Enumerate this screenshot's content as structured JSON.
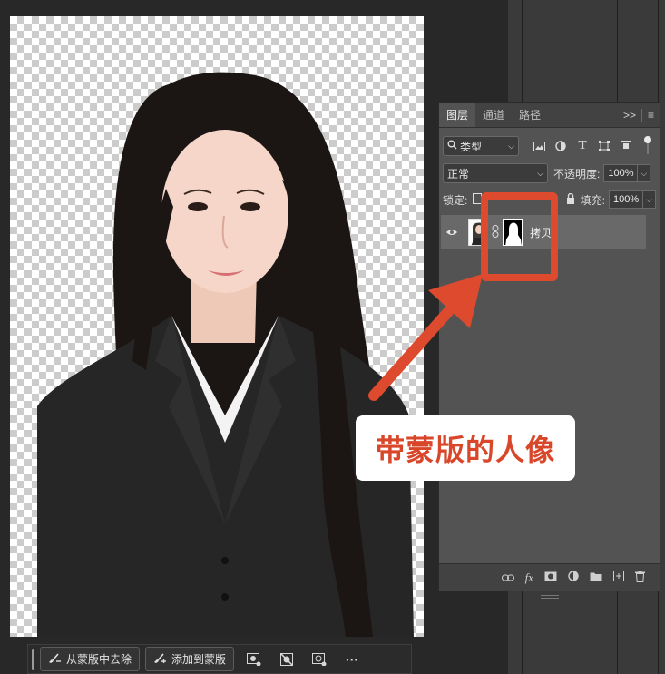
{
  "layers_panel": {
    "tabs": [
      "图层",
      "通道",
      "路径"
    ],
    "menu_collapse": ">>",
    "menu_more": "≡",
    "filter": {
      "selected": "类型"
    },
    "blend_mode": {
      "selected": "正常"
    },
    "opacity_label": "不透明度:",
    "opacity_value": "100%",
    "lock_label": "锁定:",
    "fill_label": "填充:",
    "fill_value": "100%",
    "layer": {
      "name": "拷贝",
      "visible": true
    }
  },
  "annotation": {
    "callout_text": "带蒙版的人像",
    "accent_color": "#de4a2e"
  },
  "context_bar": {
    "subtract_label": "从蒙版中去除",
    "add_label": "添加到蒙版",
    "more_label": "···"
  }
}
